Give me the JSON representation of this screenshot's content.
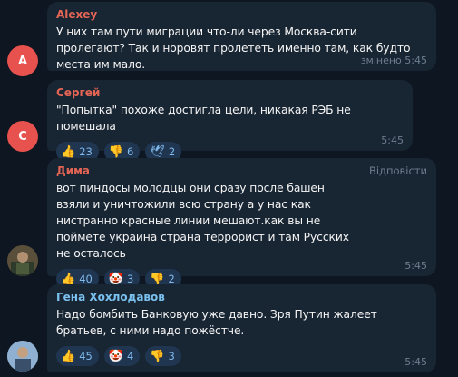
{
  "messages": [
    {
      "author": "Alexey",
      "author_color": "#e56555",
      "avatar_letter": "A",
      "avatar_color": "#e8524e",
      "text": "У них там пути миграции что-ли через Москва-сити пролегают? Так и норовят пролететь именно там, как будто места им мало.",
      "time": "змінено 5:45"
    },
    {
      "author": "Сергей",
      "author_color": "#e56555",
      "avatar_letter": "С",
      "avatar_color": "#e8524e",
      "text": "\"Попытка\" похоже достигла цели, никакая РЭБ не помешала",
      "time": "5:45",
      "reactions": [
        {
          "icon": "👍",
          "icon_name": "thumbs-up-icon",
          "count": "23"
        },
        {
          "icon": "👎",
          "icon_name": "thumbs-down-icon",
          "count": "6"
        },
        {
          "icon": "🕊",
          "icon_name": "dove-icon",
          "count": "2"
        }
      ]
    },
    {
      "author": "Дима",
      "author_color": "#e56555",
      "reply_label": "Відповісти",
      "text": "вот пиндосы молодцы они сразу после башен взяли и уничтожили всю страну а у нас как нистранно красные линии мешают.как вы не поймете украина страна террорист и там Русских не осталось",
      "time": "5:45",
      "reactions": [
        {
          "icon": "👍",
          "icon_name": "thumbs-up-icon",
          "count": "40"
        },
        {
          "icon": "🤡",
          "icon_name": "clown-icon",
          "count": "3"
        },
        {
          "icon": "👎",
          "icon_name": "thumbs-down-icon",
          "count": "2"
        }
      ]
    },
    {
      "author": "Гена Хохлодавов",
      "author_color": "#7ac1f0",
      "text": "Надо бомбить Банковую уже давно. Зря Путин жалеет братьев, с ними надо пожёстче.",
      "time": "5:45",
      "reactions": [
        {
          "icon": "👍",
          "icon_name": "thumbs-up-icon",
          "count": "45"
        },
        {
          "icon": "🤡",
          "icon_name": "clown-icon",
          "count": "4"
        },
        {
          "icon": "👎",
          "icon_name": "thumbs-down-icon",
          "count": "3"
        }
      ]
    }
  ]
}
